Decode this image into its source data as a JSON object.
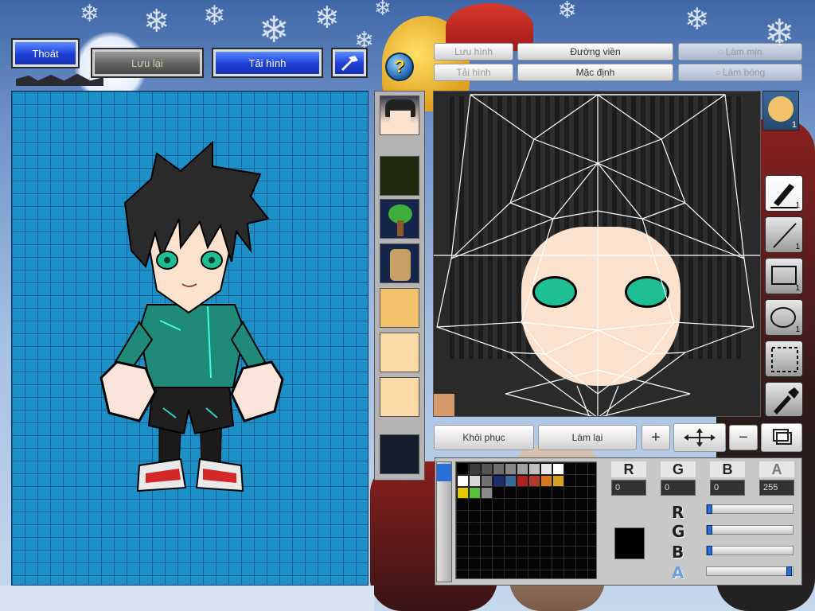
{
  "top_buttons": {
    "exit": "Thoát",
    "save": "Lưu lại",
    "reload": "Tải hình"
  },
  "editor_buttons": {
    "save_image": "Lưu hình",
    "outline": "Đường viền",
    "smooth": "Làm mịn",
    "load_image": "Tải hình",
    "default": "Mặc định",
    "shine": "Làm bóng"
  },
  "help_glyph": "?",
  "canvas_actions": {
    "restore": "Khôi phục",
    "redo": "Làm lại"
  },
  "tools": [
    {
      "name": "brush",
      "size": "1"
    },
    {
      "name": "line",
      "size": "1"
    },
    {
      "name": "rectangle",
      "size": "1"
    },
    {
      "name": "ellipse",
      "size": "1"
    },
    {
      "name": "selection"
    },
    {
      "name": "eyedropper"
    }
  ],
  "color_channels": {
    "r_label": "R",
    "g_label": "G",
    "b_label": "B",
    "a_label": "A",
    "r_value": "0",
    "g_value": "0",
    "b_value": "0",
    "a_value": "255"
  },
  "sliders": {
    "r": 0,
    "g": 0,
    "b": 0,
    "a": 255
  },
  "current_color": "#000000",
  "palette_row1": [
    "#000000",
    "#3c3c3c",
    "#555555",
    "#6d6d6d",
    "#888888",
    "#a0a0a0",
    "#c0c0c0",
    "#e8e8e8",
    "#ffffff"
  ],
  "palette_row2": [
    "#ffffff",
    "#d8d8d8",
    "#707078",
    "#1f2e6e",
    "#3a6a9c",
    "#b02020",
    "#b33a2a",
    "#d8781e",
    "#d8a020"
  ],
  "palette_row3": [
    "#e6c700",
    "#58c038",
    "#8a8a8a"
  ],
  "colors": {
    "grid_bg": "#1e90c8",
    "button_blue": "#1d3ed8",
    "panel_gray": "#b4b4b4"
  }
}
